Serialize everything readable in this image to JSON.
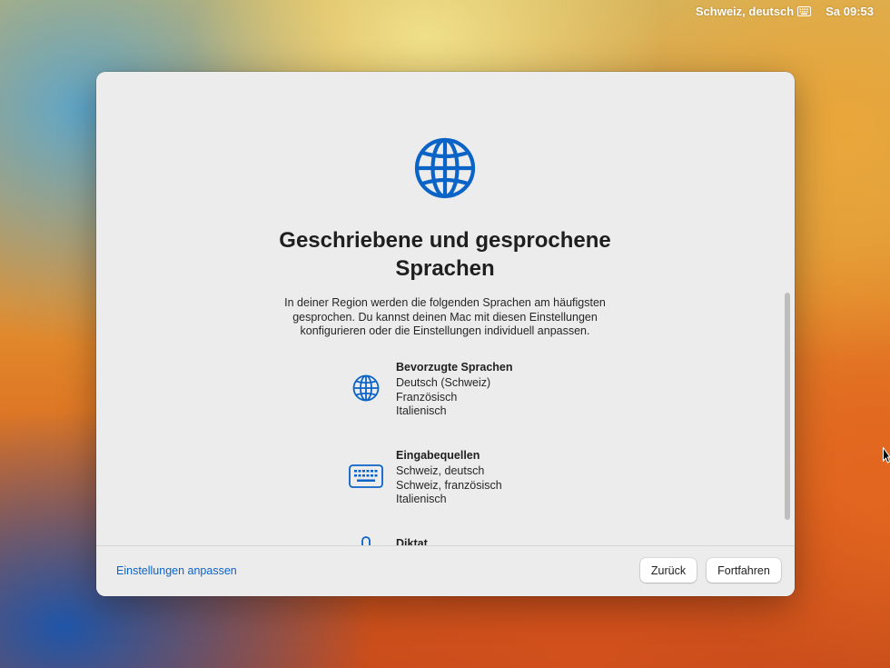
{
  "menubar": {
    "input_source": "Schweiz, deutsch",
    "input_source_icon": "keyboard-icon",
    "clock": "Sa 09:53"
  },
  "dialog": {
    "icon": "globe-icon",
    "title_line1": "Geschriebene und gesprochene",
    "title_line2": "Sprachen",
    "description_line1": "In deiner Region werden die folgenden Sprachen am häufigsten",
    "description_line2": "gesprochen. Du kannst deinen Mac mit diesen Einstellungen",
    "description_line3": "konfigurieren oder die Einstellungen individuell anpassen.",
    "sections": [
      {
        "icon": "globe-icon",
        "title": "Bevorzugte Sprachen",
        "items": [
          "Deutsch (Schweiz)",
          "Französisch",
          "Italienisch"
        ]
      },
      {
        "icon": "keyboard-icon",
        "title": "Eingabequellen",
        "items": [
          "Schweiz, deutsch",
          "Schweiz, französisch",
          "Italienisch"
        ]
      },
      {
        "icon": "microphone-icon",
        "title": "Diktat",
        "items": []
      }
    ],
    "footer": {
      "customize_link": "Einstellungen anpassen",
      "back_button": "Zurück",
      "continue_button": "Fortfahren"
    }
  },
  "colors": {
    "accent": "#0a63c7",
    "window_bg": "#ececec"
  }
}
